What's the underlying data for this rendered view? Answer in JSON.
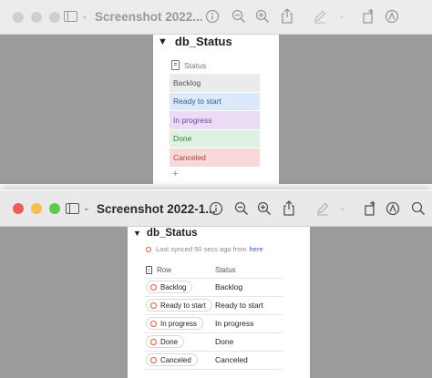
{
  "colors": {
    "close": "#ee5e58",
    "minimize": "#f5be4f",
    "zoom": "#5fc94e",
    "inactive_dot": "#cfcfcf",
    "backlog_bg": "#ebebeb",
    "ready_bg": "#dce9fb",
    "progress_bg": "#eadcf5",
    "done_bg": "#dff2e1",
    "canceled_bg": "#f7d9d9"
  },
  "back_window": {
    "title": "Screenshot 2022...",
    "page": {
      "heading": "db_Status",
      "column_header": "Status",
      "options": [
        {
          "label": "Backlog",
          "text_color": "#555555"
        },
        {
          "label": "Ready to start",
          "text_color": "#2f5aa8"
        },
        {
          "label": "In progress",
          "text_color": "#7a3fb0"
        },
        {
          "label": "Done",
          "text_color": "#2f7a3a"
        },
        {
          "label": "Canceled",
          "text_color": "#b23b3b"
        }
      ],
      "add_label": "+"
    }
  },
  "front_window": {
    "title": "Screenshot 2022-1...",
    "page": {
      "heading": "db_Status",
      "synced_text": "Last synced 50 secs ago from",
      "synced_link": "here",
      "col_row": "Row",
      "col_status": "Status",
      "rows": [
        {
          "row": "Backlog",
          "status": "Backlog"
        },
        {
          "row": "Ready to start",
          "status": "Ready to start"
        },
        {
          "row": "In progress",
          "status": "In progress"
        },
        {
          "row": "Done",
          "status": "Done"
        },
        {
          "row": "Canceled",
          "status": "Canceled"
        }
      ]
    }
  }
}
